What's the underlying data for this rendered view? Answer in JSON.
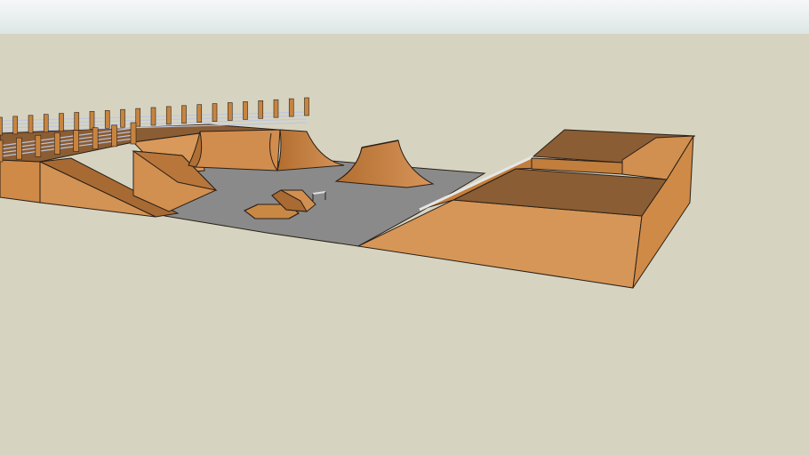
{
  "scene": {
    "colors": {
      "sky_top": "#f6f8f8",
      "sky_bottom": "#dde6e6",
      "ground": "#d6d4c0",
      "concrete": "#8a8a8a",
      "concrete_dark": "#6e6e6e",
      "wood_light": "#d89c5c",
      "wood_mid": "#c8843f",
      "wood_dark": "#7a5230",
      "wood_top": "#8a5d34",
      "rail": "#bfc6e0",
      "edge": "#2a2018",
      "coping": "#dcdcdc"
    },
    "objects": [
      "concrete-floor",
      "left-deck-platform",
      "left-fence",
      "left-launch-ramp",
      "back-quarter-pipe",
      "center-quarter-pipe",
      "funbox-with-rail",
      "right-box-platform",
      "right-bank-ramp",
      "right-upper-deck"
    ]
  }
}
